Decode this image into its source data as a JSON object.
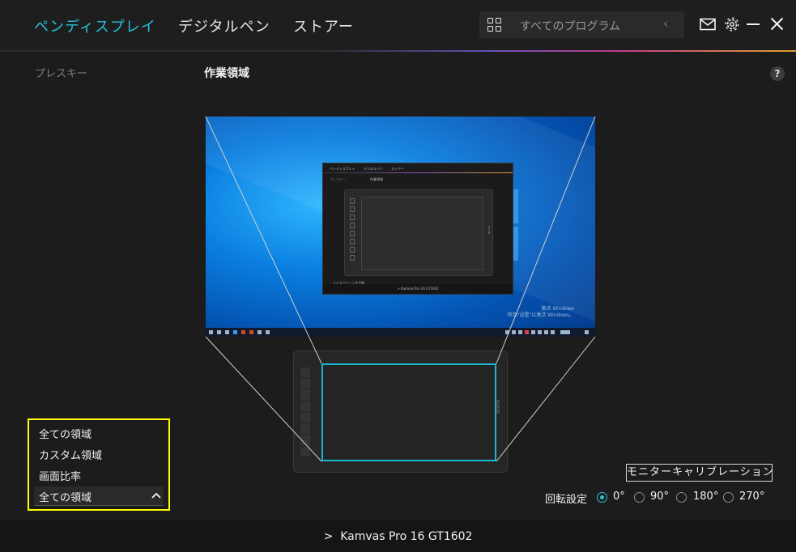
{
  "header": {
    "tabs": [
      {
        "label": "ペンディスプレイ",
        "active": true
      },
      {
        "label": "デジタルペン",
        "active": false
      },
      {
        "label": "ストアー",
        "active": false
      }
    ],
    "search_label": "すべてのプログラム",
    "accent_color": "#27c1d8",
    "icons": [
      "grid-icon",
      "chevron-left-icon",
      "mail-icon",
      "gear-icon",
      "minimize-icon",
      "close-icon"
    ]
  },
  "sidebar": {
    "items": [
      {
        "label": "プレスキー"
      }
    ]
  },
  "main": {
    "title": "作業領域",
    "help": "?"
  },
  "mini_screen": {
    "tabs": [
      "ペンディスプレイ",
      "デジタルペン",
      "ストアー"
    ],
    "sidebar": "プレスキー",
    "title": "作業領域",
    "checkbox": "ミニスクリーンを回転",
    "device": "> Kamvas Pro 16 GT1602",
    "watermark_line1": "激活 Windows",
    "watermark_line2": "转到\"设置\"以激活 Windows。",
    "tablet_brand": "HUION"
  },
  "tablet": {
    "brand": "HUION"
  },
  "area_dropdown": {
    "options": [
      "全ての領域",
      "カスタム領域",
      "画面比率"
    ],
    "selected": "全ての領域",
    "caret": "^"
  },
  "calibration_button": "モニターキャリブレーション",
  "rotation": {
    "label": "回転設定",
    "options": [
      "0°",
      "90°",
      "180°",
      "270°"
    ],
    "selected": "0°"
  },
  "footer": {
    "device": "Kamvas Pro 16 GT1602",
    "chevron": ">"
  }
}
